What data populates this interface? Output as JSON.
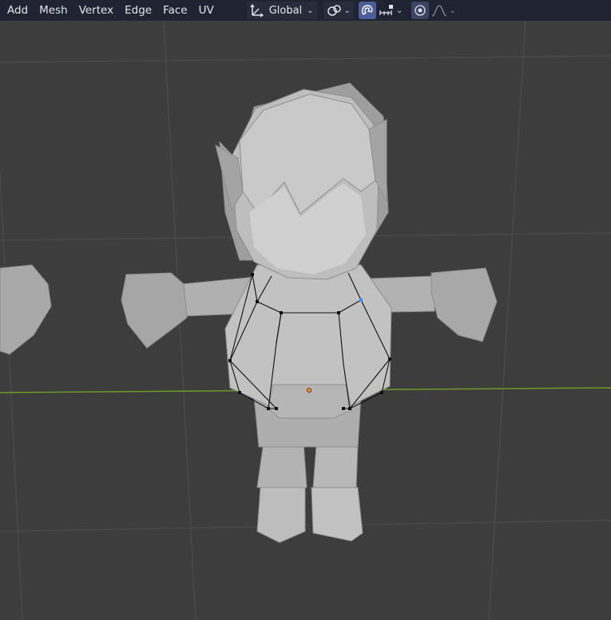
{
  "menu": {
    "add": "Add",
    "mesh": "Mesh",
    "vertex": "Vertex",
    "edge": "Edge",
    "face": "Face",
    "uv": "UV"
  },
  "toolbar": {
    "transform_orientation": "Global",
    "transform_icon": "transform-orientation-icon",
    "pivot_icon": "pivot-point-icon",
    "snap_icon": "snap-magnet-icon",
    "snap_type_icon": "snap-increment-icon",
    "proportional_icon": "proportional-editing-icon",
    "falloff_icon": "falloff-curve-icon"
  },
  "colors": {
    "header_bg": "#202432",
    "viewport_bg": "#3d3d3d",
    "grid_line": "#4b4b4b",
    "x_axis": "#6d9a2a",
    "mesh": "#b7b7b7",
    "selected_vertex": "#3d8fff",
    "origin": "#ff8a1f",
    "active_toggle": "#4a5d99"
  }
}
